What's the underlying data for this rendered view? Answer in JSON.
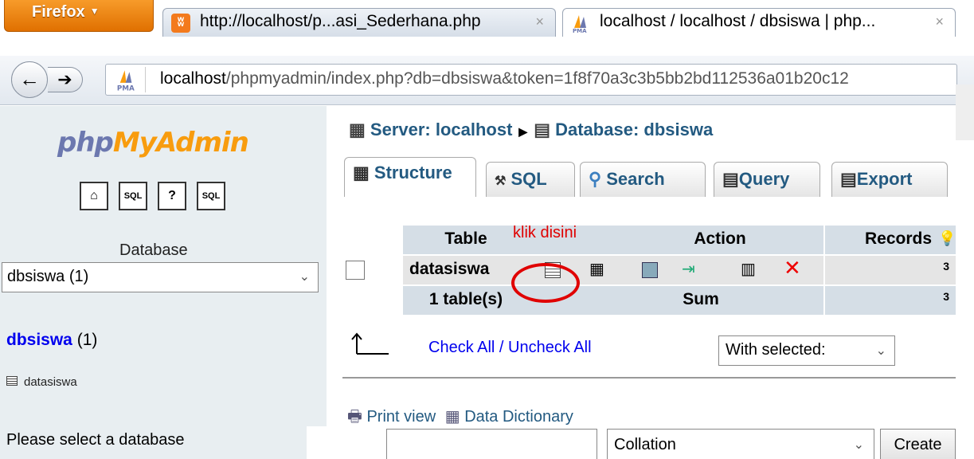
{
  "browser": {
    "menu_label": "Firefox",
    "tabs": [
      {
        "title": "http://localhost/p...asi_Sederhana.php",
        "close": "×"
      },
      {
        "title": "localhost / localhost / dbsiswa | php...",
        "close": "×"
      }
    ],
    "url_host": "localhost",
    "url_path": "/phpmyadmin/index.php?db=dbsiswa&token=1f8f70a3c3b5bb2bd112536a01b20c12"
  },
  "sidebar": {
    "logo_php": "php",
    "logo_my": "My",
    "logo_admin": "Admin",
    "database_label": "Database",
    "database_select": "dbsiswa (1)",
    "db_link": "dbsiswa",
    "db_count": " (1)",
    "table_item": "datasiswa",
    "select_message": "Please select a database"
  },
  "main": {
    "server_crumb": "Server: localhost",
    "database_crumb": "Database: dbsiswa",
    "tabs": [
      "Structure",
      "SQL",
      "Search",
      "Query",
      "Export"
    ],
    "table": {
      "headers": {
        "table": "Table",
        "action": "Action",
        "records": "Records"
      },
      "annotation": "klik disini",
      "rows": [
        {
          "name": "datasiswa",
          "records": "3"
        }
      ],
      "footer": {
        "label": "1 table(s)",
        "sum_label": "Sum",
        "records": "3"
      }
    },
    "check_all": "Check All",
    "check_sep": " / ",
    "uncheck_all": "Uncheck All",
    "with_selected": "With selected:",
    "print_view": "Print view",
    "data_dictionary": "Data Dictionary",
    "collation": "Collation",
    "create": "Create"
  }
}
